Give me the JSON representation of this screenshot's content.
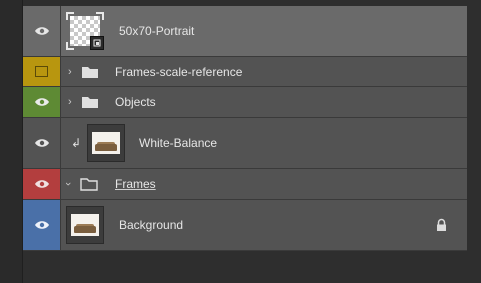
{
  "layers_panel": {
    "colors": {
      "yellow": "#b8960f",
      "green": "#5e8a34",
      "red": "#b33e3e",
      "blue": "#4a70a8"
    },
    "layers": [
      {
        "name": "50x70-Portrait",
        "kind": "smart-object",
        "visible": true,
        "selected": true
      },
      {
        "name": "Frames-scale-reference",
        "kind": "group",
        "collapsed": true,
        "visible": false,
        "color": "yellow"
      },
      {
        "name": "Objects",
        "kind": "group",
        "collapsed": true,
        "visible": true,
        "color": "green"
      },
      {
        "name": "White-Balance",
        "kind": "clipped-layer",
        "visible": true
      },
      {
        "name": "Frames",
        "kind": "group",
        "collapsed": false,
        "visible": true,
        "color": "red"
      },
      {
        "name": "Background",
        "kind": "locked-layer",
        "visible": true,
        "color": "blue",
        "locked": true
      }
    ]
  }
}
